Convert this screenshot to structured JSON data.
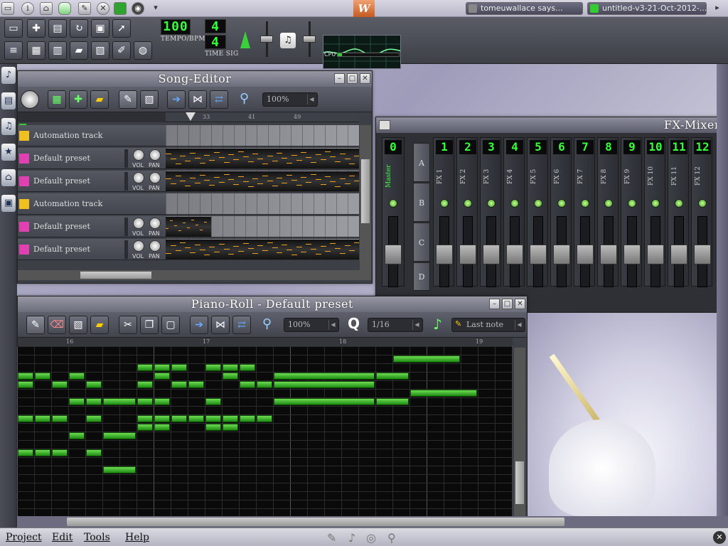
{
  "taskbar": {
    "tasks": [
      {
        "label": "tomeuwallace says..."
      },
      {
        "label": "untitled-v3-21-Oct-2012-..."
      }
    ],
    "center_label": "W"
  },
  "toolbar": {
    "tempo_value": "100",
    "tempo_label": "TEMPO/BPM",
    "timesig_num": "4",
    "timesig_den": "4",
    "timesig_label": "TIME SIG",
    "cpu_label": "CPU"
  },
  "song_editor": {
    "title": "Song-Editor",
    "zoom": "100%",
    "ruler": [
      "33",
      "41",
      "49"
    ],
    "tracks": [
      {
        "type": "automation",
        "name": "Automation track"
      },
      {
        "type": "instrument",
        "name": "Default preset"
      },
      {
        "type": "instrument",
        "name": "Default preset"
      },
      {
        "type": "automation",
        "name": "Automation track"
      },
      {
        "type": "instrument",
        "name": "Default preset"
      },
      {
        "type": "instrument",
        "name": "Default preset"
      }
    ],
    "vol_label": "VOL",
    "pan_label": "PAN"
  },
  "fx_mixer": {
    "title": "FX-Mixer",
    "master_num": "0",
    "master_label": "Master",
    "sends": [
      "A",
      "B",
      "C",
      "D"
    ],
    "channels": [
      {
        "num": "1",
        "name": "FX 1"
      },
      {
        "num": "2",
        "name": "FX 2"
      },
      {
        "num": "3",
        "name": "FX 3"
      },
      {
        "num": "4",
        "name": "FX 4"
      },
      {
        "num": "5",
        "name": "FX 5"
      },
      {
        "num": "6",
        "name": "FX 6"
      },
      {
        "num": "7",
        "name": "FX 7"
      },
      {
        "num": "8",
        "name": "FX 8"
      },
      {
        "num": "9",
        "name": "FX 9"
      },
      {
        "num": "10",
        "name": "FX 10"
      },
      {
        "num": "11",
        "name": "FX 11"
      },
      {
        "num": "12",
        "name": "FX 12"
      }
    ]
  },
  "piano_roll": {
    "title": "Piano-Roll - Default preset",
    "zoom": "100%",
    "quantize_label": "Q",
    "quantize": "1/16",
    "note_length": "Last note",
    "ruler": [
      "16",
      "17",
      "18",
      "19"
    ],
    "notes": [
      {
        "row": 1,
        "col": 22,
        "len": 4
      },
      {
        "row": 2,
        "col": 7,
        "len": 1
      },
      {
        "row": 2,
        "col": 8,
        "len": 1
      },
      {
        "row": 2,
        "col": 9,
        "len": 1
      },
      {
        "row": 2,
        "col": 11,
        "len": 1
      },
      {
        "row": 2,
        "col": 12,
        "len": 1
      },
      {
        "row": 2,
        "col": 13,
        "len": 1
      },
      {
        "row": 3,
        "col": 0,
        "len": 1
      },
      {
        "row": 3,
        "col": 1,
        "len": 1
      },
      {
        "row": 3,
        "col": 3,
        "len": 1
      },
      {
        "row": 3,
        "col": 8,
        "len": 1
      },
      {
        "row": 3,
        "col": 12,
        "len": 1
      },
      {
        "row": 3,
        "col": 15,
        "len": 6
      },
      {
        "row": 3,
        "col": 21,
        "len": 2
      },
      {
        "row": 4,
        "col": 0,
        "len": 1
      },
      {
        "row": 4,
        "col": 2,
        "len": 1
      },
      {
        "row": 4,
        "col": 4,
        "len": 1
      },
      {
        "row": 4,
        "col": 7,
        "len": 1
      },
      {
        "row": 4,
        "col": 9,
        "len": 1
      },
      {
        "row": 4,
        "col": 10,
        "len": 1
      },
      {
        "row": 4,
        "col": 13,
        "len": 1
      },
      {
        "row": 4,
        "col": 14,
        "len": 1
      },
      {
        "row": 4,
        "col": 15,
        "len": 6
      },
      {
        "row": 5,
        "col": 23,
        "len": 4
      },
      {
        "row": 6,
        "col": 3,
        "len": 1
      },
      {
        "row": 6,
        "col": 4,
        "len": 1
      },
      {
        "row": 6,
        "col": 5,
        "len": 2
      },
      {
        "row": 6,
        "col": 7,
        "len": 1
      },
      {
        "row": 6,
        "col": 8,
        "len": 1
      },
      {
        "row": 6,
        "col": 11,
        "len": 1
      },
      {
        "row": 6,
        "col": 15,
        "len": 6
      },
      {
        "row": 6,
        "col": 21,
        "len": 2
      },
      {
        "row": 8,
        "col": 0,
        "len": 1
      },
      {
        "row": 8,
        "col": 1,
        "len": 1
      },
      {
        "row": 8,
        "col": 2,
        "len": 1
      },
      {
        "row": 8,
        "col": 4,
        "len": 1
      },
      {
        "row": 8,
        "col": 7,
        "len": 1
      },
      {
        "row": 8,
        "col": 8,
        "len": 1
      },
      {
        "row": 8,
        "col": 9,
        "len": 1
      },
      {
        "row": 8,
        "col": 10,
        "len": 1
      },
      {
        "row": 8,
        "col": 11,
        "len": 1
      },
      {
        "row": 8,
        "col": 12,
        "len": 1
      },
      {
        "row": 8,
        "col": 13,
        "len": 1
      },
      {
        "row": 8,
        "col": 14,
        "len": 1
      },
      {
        "row": 9,
        "col": 7,
        "len": 1
      },
      {
        "row": 9,
        "col": 8,
        "len": 1
      },
      {
        "row": 9,
        "col": 11,
        "len": 1
      },
      {
        "row": 9,
        "col": 12,
        "len": 1
      },
      {
        "row": 10,
        "col": 3,
        "len": 1
      },
      {
        "row": 10,
        "col": 5,
        "len": 2
      },
      {
        "row": 12,
        "col": 0,
        "len": 1
      },
      {
        "row": 12,
        "col": 1,
        "len": 1
      },
      {
        "row": 12,
        "col": 2,
        "len": 1
      },
      {
        "row": 12,
        "col": 4,
        "len": 1
      },
      {
        "row": 14,
        "col": 5,
        "len": 2
      }
    ]
  },
  "menubar": {
    "items": [
      "Project",
      "Edit",
      "Tools",
      "Help"
    ]
  },
  "colors": {
    "lcd_green": "#35ff3b",
    "note_green": "#2fb51e",
    "pattern_orange": "#f0a020"
  }
}
